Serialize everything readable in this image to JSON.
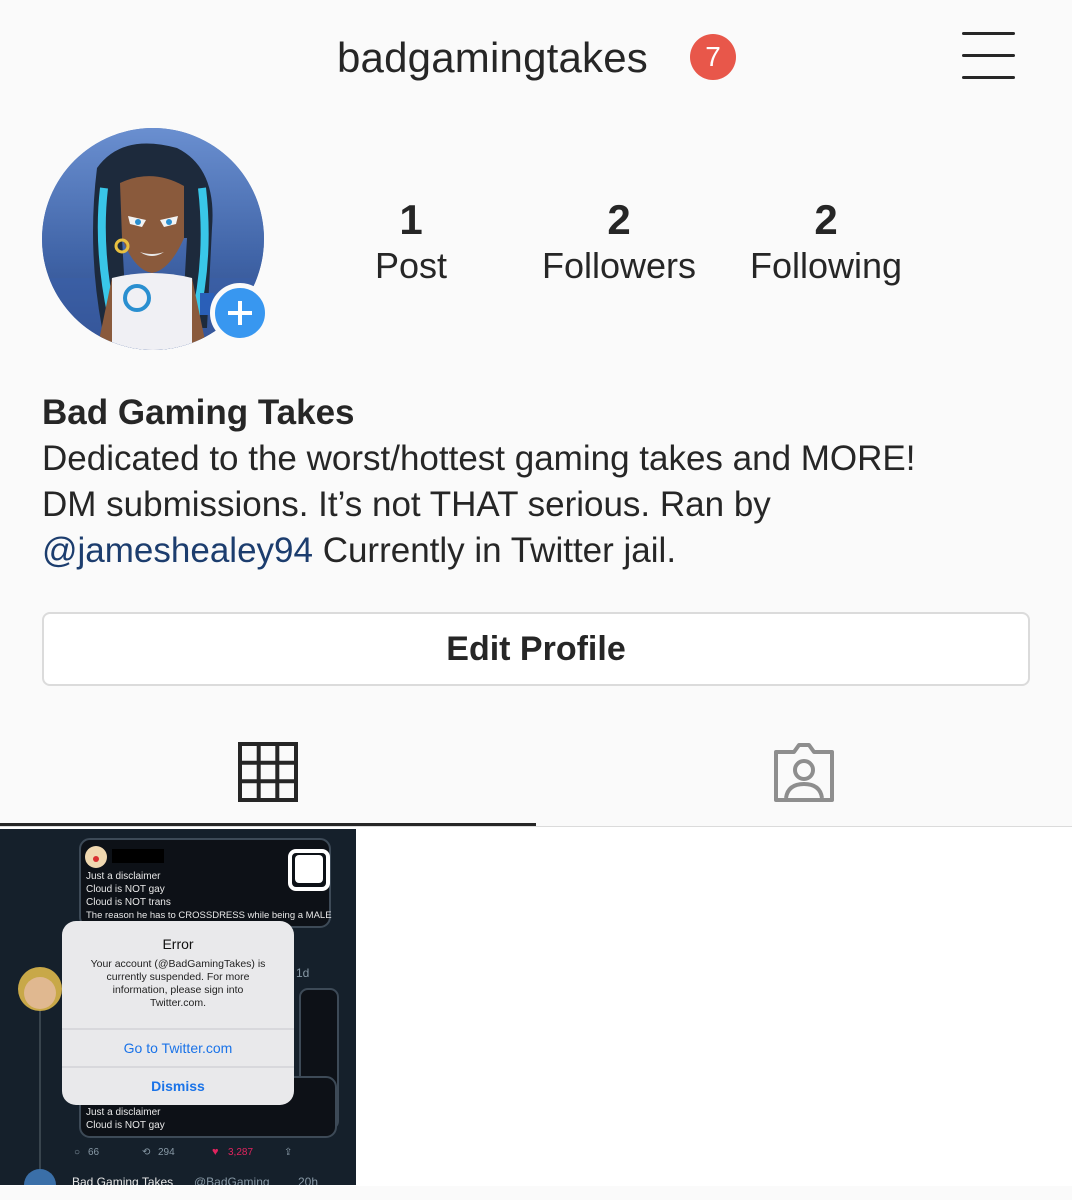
{
  "header": {
    "username": "badgamingtakes",
    "notification_count": "7",
    "menu_icon": "hamburger-menu-icon"
  },
  "profile": {
    "stats": [
      {
        "value": "1",
        "label": "Post"
      },
      {
        "value": "2",
        "label": "Followers"
      },
      {
        "value": "2",
        "label": "Following"
      }
    ],
    "name": "Bad Gaming Takes",
    "bio_line1": "Dedicated to the worst/hottest gaming takes and MORE!",
    "bio_line2": "DM submissions. It’s not THAT serious. Ran by",
    "bio_mention": "@jameshealey94",
    "bio_line3_rest": " Currently in Twitter jail.",
    "edit_button": "Edit Profile"
  },
  "tabs": [
    {
      "name": "grid",
      "icon": "grid-icon",
      "active": true
    },
    {
      "name": "tagged",
      "icon": "tagged-person-icon",
      "active": false
    }
  ],
  "post": {
    "tweet_top_lines": [
      "Just a disclaimer",
      "Cloud is NOT gay",
      "Cloud is NOT trans",
      "The reason he has to CROSSDRESS while being a MALE"
    ],
    "dialog_title": "Error",
    "dialog_message": [
      "Your account (@BadGamingTakes) is",
      "currently suspended. For more",
      "information, please sign into",
      "Twitter.com."
    ],
    "dialog_primary": "Go to Twitter.com",
    "dialog_dismiss": "Dismiss",
    "tweet_time": "1d",
    "tweet_bottom_lines": [
      "Just a disclaimer",
      "Cloud is NOT gay"
    ],
    "replies": "66",
    "retweets": "294",
    "likes": "3,287",
    "footer_name": "Bad Gaming Takes",
    "footer_handle": "@BadGaming",
    "footer_time": "20h"
  },
  "colors": {
    "badge": "#e8574a",
    "add_button": "#3897f0",
    "mention": "#1c3d6e",
    "twitter_bg": "#15202b",
    "dialog_link": "#1a73e8",
    "like": "#e0245e"
  }
}
